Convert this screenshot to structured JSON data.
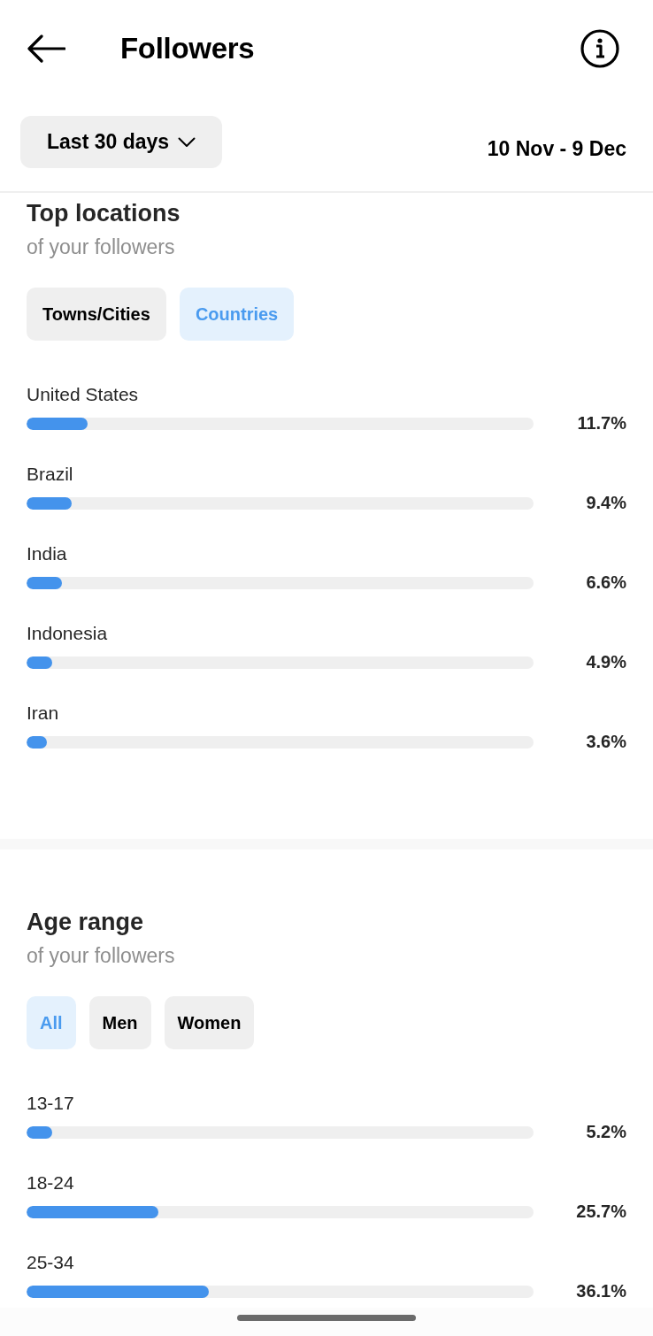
{
  "header": {
    "title": "Followers"
  },
  "date_filter": {
    "period": "Last 30 days",
    "range": "10 Nov - 9 Dec"
  },
  "sections": [
    {
      "title": "Top locations",
      "subtitle": "of your followers",
      "filters": [
        {
          "label": "Towns/Cities",
          "selected": false
        },
        {
          "label": "Countries",
          "selected": true
        }
      ],
      "rows": [
        {
          "label": "United States",
          "level": 0.12,
          "value": "11.7%"
        },
        {
          "label": "Brazil",
          "level": 0.089,
          "value": "9.4%"
        },
        {
          "label": "India",
          "level": 0.07,
          "value": "6.6%"
        },
        {
          "label": "Indonesia",
          "level": 0.05,
          "value": "4.9%"
        },
        {
          "label": "Iran",
          "level": 0.04,
          "value": "3.6%"
        }
      ]
    },
    {
      "title": "Age range",
      "subtitle": "of your followers",
      "filters": [
        {
          "label": "All",
          "selected": true
        },
        {
          "label": "Men",
          "selected": false
        },
        {
          "label": "Women",
          "selected": false
        }
      ],
      "rows": [
        {
          "label": "13-17",
          "level": 0.05,
          "value": "5.2%"
        },
        {
          "label": "18-24",
          "level": 0.26,
          "value": "25.7%"
        },
        {
          "label": "25-34",
          "level": 0.36,
          "value": "36.1%"
        }
      ]
    }
  ]
}
